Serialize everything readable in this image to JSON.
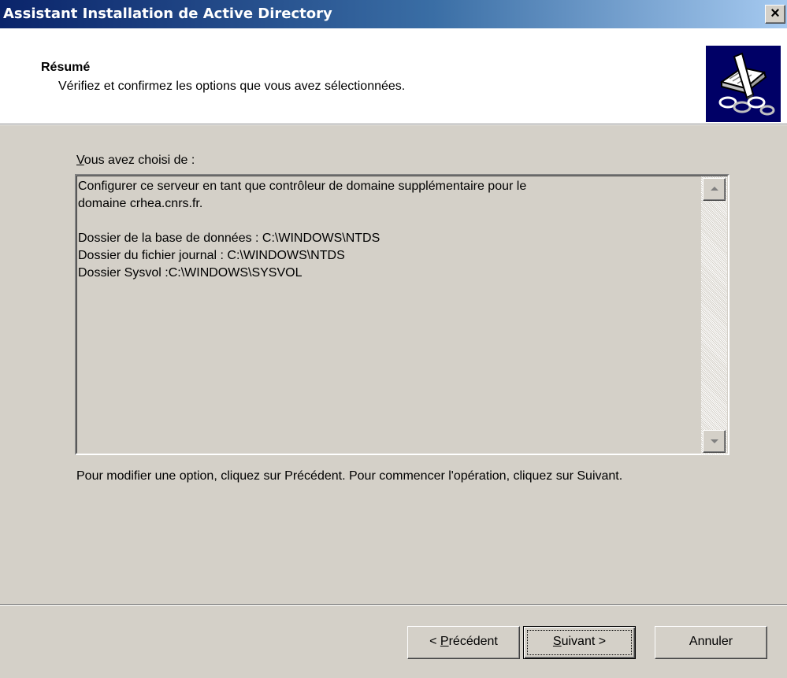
{
  "window": {
    "title": "Assistant Installation de Active Directory",
    "close_label": "×"
  },
  "header": {
    "title": "Résumé",
    "subtitle": "Vérifiez et confirmez les options que vous avez sélectionnées.",
    "icon": "wizard-book-icon"
  },
  "summary": {
    "label_access_key": "V",
    "label_rest": "ous avez choisi de :",
    "text": "Configurer ce serveur en tant que contrôleur de domaine supplémentaire pour le\ndomaine crhea.cnrs.fr.\n\nDossier de la base de données : C:\\WINDOWS\\NTDS\nDossier du fichier journal : C:\\WINDOWS\\NTDS\nDossier Sysvol :C:\\WINDOWS\\SYSVOL"
  },
  "instruction": "Pour modifier une option, cliquez sur Précédent. Pour commencer l'opération, cliquez sur Suivant.",
  "buttons": {
    "back_prefix": "< ",
    "back_key": "P",
    "back_rest": "récédent",
    "next_key": "S",
    "next_rest": "uivant >",
    "cancel": "Annuler"
  },
  "colors": {
    "titlebar_start": "#0a246a",
    "titlebar_end": "#a6caf0",
    "face": "#d4d0c8",
    "icon_bg": "#000066"
  }
}
